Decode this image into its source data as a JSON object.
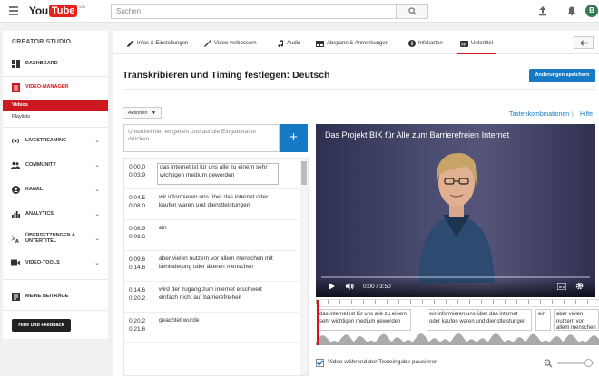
{
  "topbar": {
    "logo_you": "You",
    "logo_tube": "Tube",
    "logo_region": "DE",
    "search_placeholder": "Suchen",
    "avatar_letter": "B"
  },
  "sidebar": {
    "title": "CREATOR STUDIO",
    "items": [
      {
        "label": "DASHBOARD",
        "icon": "dashboard-icon"
      },
      {
        "label": "VIDEO-MANAGER",
        "icon": "video-manager-icon",
        "active": true
      },
      {
        "label": "LIVESTREAMING",
        "icon": "livestream-icon"
      },
      {
        "label": "COMMUNITY",
        "icon": "community-icon"
      },
      {
        "label": "KANAL",
        "icon": "channel-icon"
      },
      {
        "label": "ANALYTICS",
        "icon": "analytics-icon"
      },
      {
        "label": "ÜBERSETZUNGEN & UNTERTITEL",
        "icon": "translate-icon"
      },
      {
        "label": "VIDEO-TOOLS",
        "icon": "video-tools-icon"
      },
      {
        "label": "MEINE BEITRÄGE",
        "icon": "contributions-icon"
      }
    ],
    "subitems": {
      "videos": "Videos",
      "playlists": "Playlists"
    },
    "help_button": "Hilfe und Feedback"
  },
  "tabs": [
    {
      "label": "Infos & Einstellungen",
      "icon": "pencil-icon"
    },
    {
      "label": "Video verbessern",
      "icon": "magic-wand-icon"
    },
    {
      "label": "Audio",
      "icon": "music-note-icon"
    },
    {
      "label": "Abspann & Anmerkungen",
      "icon": "end-screen-icon"
    },
    {
      "label": "Infokarten",
      "icon": "info-icon"
    },
    {
      "label": "Untertitel",
      "icon": "cc-icon",
      "active": true
    }
  ],
  "page": {
    "title": "Transkribieren und Timing festlegen: Deutsch",
    "save_label": "Änderungen speichern",
    "actions_label": "Aktionen",
    "shortcuts_link": "Tastenkombinationen",
    "separator": "|",
    "help_link": "Hilfe",
    "input_placeholder": "Untertitel hier eingeben und auf die Eingabetaste drücken",
    "add_label": "+"
  },
  "cues": [
    {
      "start": "0:00.0",
      "end": "0:03.9",
      "text": "das internet ist für uns alle zu einem sehr wichtigen medium geworden"
    },
    {
      "start": "0:04.5",
      "end": "0:08.0",
      "text": "wir informieren uns über das internet oder kaufen waren und dienstleistungen"
    },
    {
      "start": "0:08.9",
      "end": "0:09.6",
      "text": "ein"
    },
    {
      "start": "0:09.6",
      "end": "0:14.6",
      "text": "aber vielen nutzern vor allem menschen mit behinderung oder älteren menschen"
    },
    {
      "start": "0:14.6",
      "end": "0:20.2",
      "text": "wird der zugang zum internet erschwert einfach nicht auf barrierefreiheit"
    },
    {
      "start": "0:20.2",
      "end": "0:21.6",
      "text": "geachtet wurde"
    }
  ],
  "video": {
    "title": "Das Projekt BIK für Alle zum Barrierefreien Internet",
    "time": "0:00 / 3:50"
  },
  "timeline": [
    {
      "text": "das internet ist für uns alle zu einem sehr wichtigen medium geworden"
    },
    {
      "text": "wir informieren uns über das internet oder kaufen waren und dienstleistungen"
    },
    {
      "text": "ein"
    },
    {
      "text": "aber vielen nutzern vor allem menschen mit behinderung ode"
    }
  ],
  "options": {
    "pause_label": "Video während der Texteingabe pausieren",
    "pause_checked": true
  },
  "colors": {
    "accent_red": "#cc181e",
    "accent_blue": "#167ac6"
  }
}
